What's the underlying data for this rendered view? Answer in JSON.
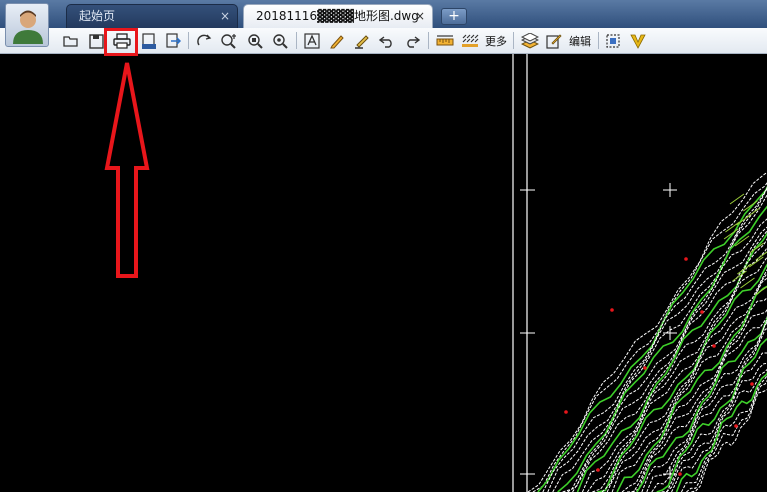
{
  "tabs": [
    {
      "label": "起始页",
      "close": "×"
    },
    {
      "label": "20181116▓▓▓▓地形图.dwg",
      "close": "×"
    }
  ],
  "new_tab_label": "+",
  "toolbar": {
    "more_label": "更多",
    "edit_label": "编辑",
    "buttons": [
      "open-icon",
      "save-icon",
      "print-icon",
      "pdf-export-icon",
      "export-icon",
      "rotate-icon",
      "zoom-in-icon",
      "zoom-extents-icon",
      "zoom-window-icon",
      "text-icon",
      "pencil-icon",
      "highlighter-icon",
      "undo-icon",
      "redo-icon",
      "measure-icon",
      "hatch-icon",
      "layers-icon",
      "edit-icon",
      "select-icon",
      "v-logo-icon"
    ]
  },
  "annotation": {
    "highlight_target": "print-icon",
    "color": "#e8161b"
  },
  "colors": {
    "canvas": "#000000",
    "contour_white": "#ffffff",
    "contour_green": "#3ecf2a",
    "accent_red": "#e8161b"
  }
}
